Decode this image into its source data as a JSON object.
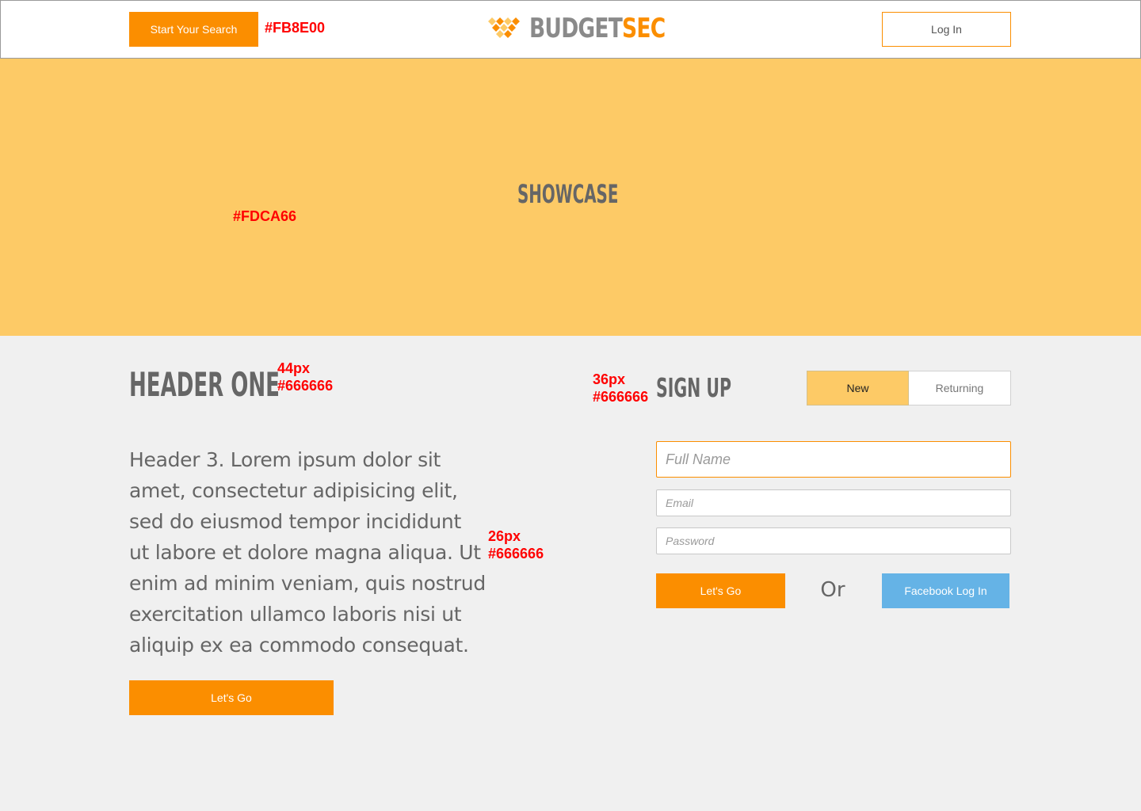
{
  "nav": {
    "search_button": "Start Your Search",
    "search_color_note": "#FB8E00",
    "logo_budget": "BUDGET",
    "logo_sec": "SEC",
    "login_button": "Log In"
  },
  "showcase": {
    "title": "SHOWCASE",
    "color_note": "#FDCA66"
  },
  "content": {
    "header_one": "HEADER ONE",
    "header_one_note_size": "44px",
    "header_one_note_color": "#666666",
    "paragraph": "Header 3. Lorem ipsum dolor sit amet, consectetur adipisicing elit, sed do eiusmod tempor incididunt ut labore et dolore magna aliqua. Ut enim ad minim veniam, quis nostrud exercitation ullamco laboris nisi ut aliquip ex ea commodo consequat.",
    "paragraph_note_size": "26px",
    "paragraph_note_color": "#666666",
    "cta_button": "Let's Go"
  },
  "signup": {
    "title": "SIGN UP",
    "title_note_size": "36px",
    "title_note_color": "#666666",
    "toggle_new": "New",
    "toggle_returning": "Returning",
    "fullname_placeholder": "Full Name",
    "email_placeholder": "Email",
    "password_placeholder": "Password",
    "submit_button": "Let's Go",
    "or_text": "Or",
    "facebook_button": "Facebook Log In"
  },
  "colors": {
    "accent": "#FB8E00",
    "showcase_bg": "#FDCA66",
    "text": "#666666",
    "facebook": "#65B3E6",
    "page_bg": "#F0F0F0"
  }
}
